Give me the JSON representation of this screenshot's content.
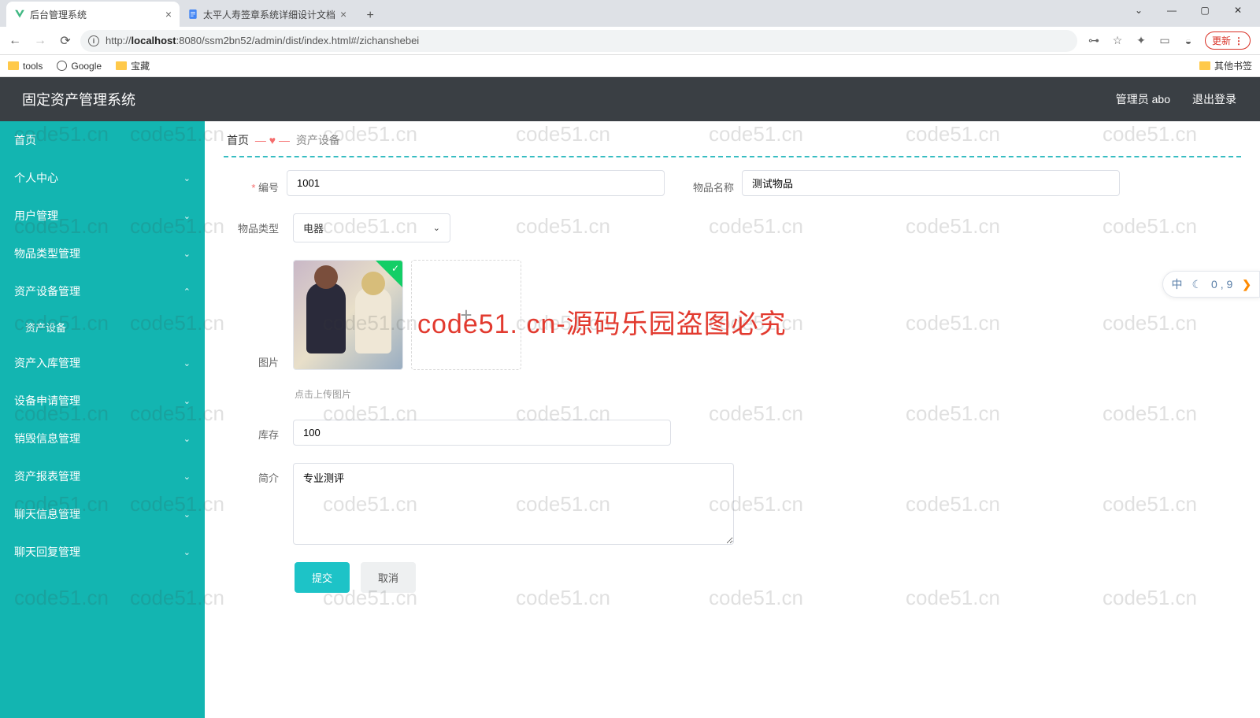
{
  "browser": {
    "tabs": [
      {
        "title": "后台管理系统",
        "active": true
      },
      {
        "title": "太平人寿签章系统详细设计文档",
        "active": false
      }
    ],
    "url_prefix": "http://",
    "url_host": "localhost",
    "url_rest": ":8080/ssm2bn52/admin/dist/index.html#/zichanshebei",
    "update_label": "更新",
    "bookmarks": {
      "tools": "tools",
      "google": "Google",
      "treasure": "宝藏",
      "others": "其他书签"
    }
  },
  "app": {
    "brand": "固定资产管理系统",
    "user_label": "管理员 abo",
    "logout": "退出登录"
  },
  "sidebar": {
    "items": [
      {
        "label": "首页",
        "expandable": false
      },
      {
        "label": "个人中心",
        "expandable": true,
        "expanded": false
      },
      {
        "label": "用户管理",
        "expandable": true,
        "expanded": false
      },
      {
        "label": "物品类型管理",
        "expandable": true,
        "expanded": false
      },
      {
        "label": "资产设备管理",
        "expandable": true,
        "expanded": true,
        "children": [
          {
            "label": "资产设备"
          }
        ]
      },
      {
        "label": "资产入库管理",
        "expandable": true,
        "expanded": false
      },
      {
        "label": "设备申请管理",
        "expandable": true,
        "expanded": false
      },
      {
        "label": "销毁信息管理",
        "expandable": true,
        "expanded": false
      },
      {
        "label": "资产报表管理",
        "expandable": true,
        "expanded": false
      },
      {
        "label": "聊天信息管理",
        "expandable": true,
        "expanded": false
      },
      {
        "label": "聊天回复管理",
        "expandable": true,
        "expanded": false
      }
    ]
  },
  "breadcrumb": {
    "home": "首页",
    "current": "资产设备"
  },
  "form": {
    "id_label": "编号",
    "id_value": "1001",
    "name_label": "物品名称",
    "name_value": "测试物品",
    "type_label": "物品类型",
    "type_value": "电器",
    "image_label": "图片",
    "upload_hint": "点击上传图片",
    "stock_label": "库存",
    "stock_value": "100",
    "intro_label": "简介",
    "intro_value": "专业测评",
    "submit": "提交",
    "cancel": "取消"
  },
  "watermark": {
    "text": "code51.cn",
    "big": "code51. cn-源码乐园盗图必究"
  },
  "side_widget": {
    "lang": "中",
    "digits": "0 , 9"
  }
}
